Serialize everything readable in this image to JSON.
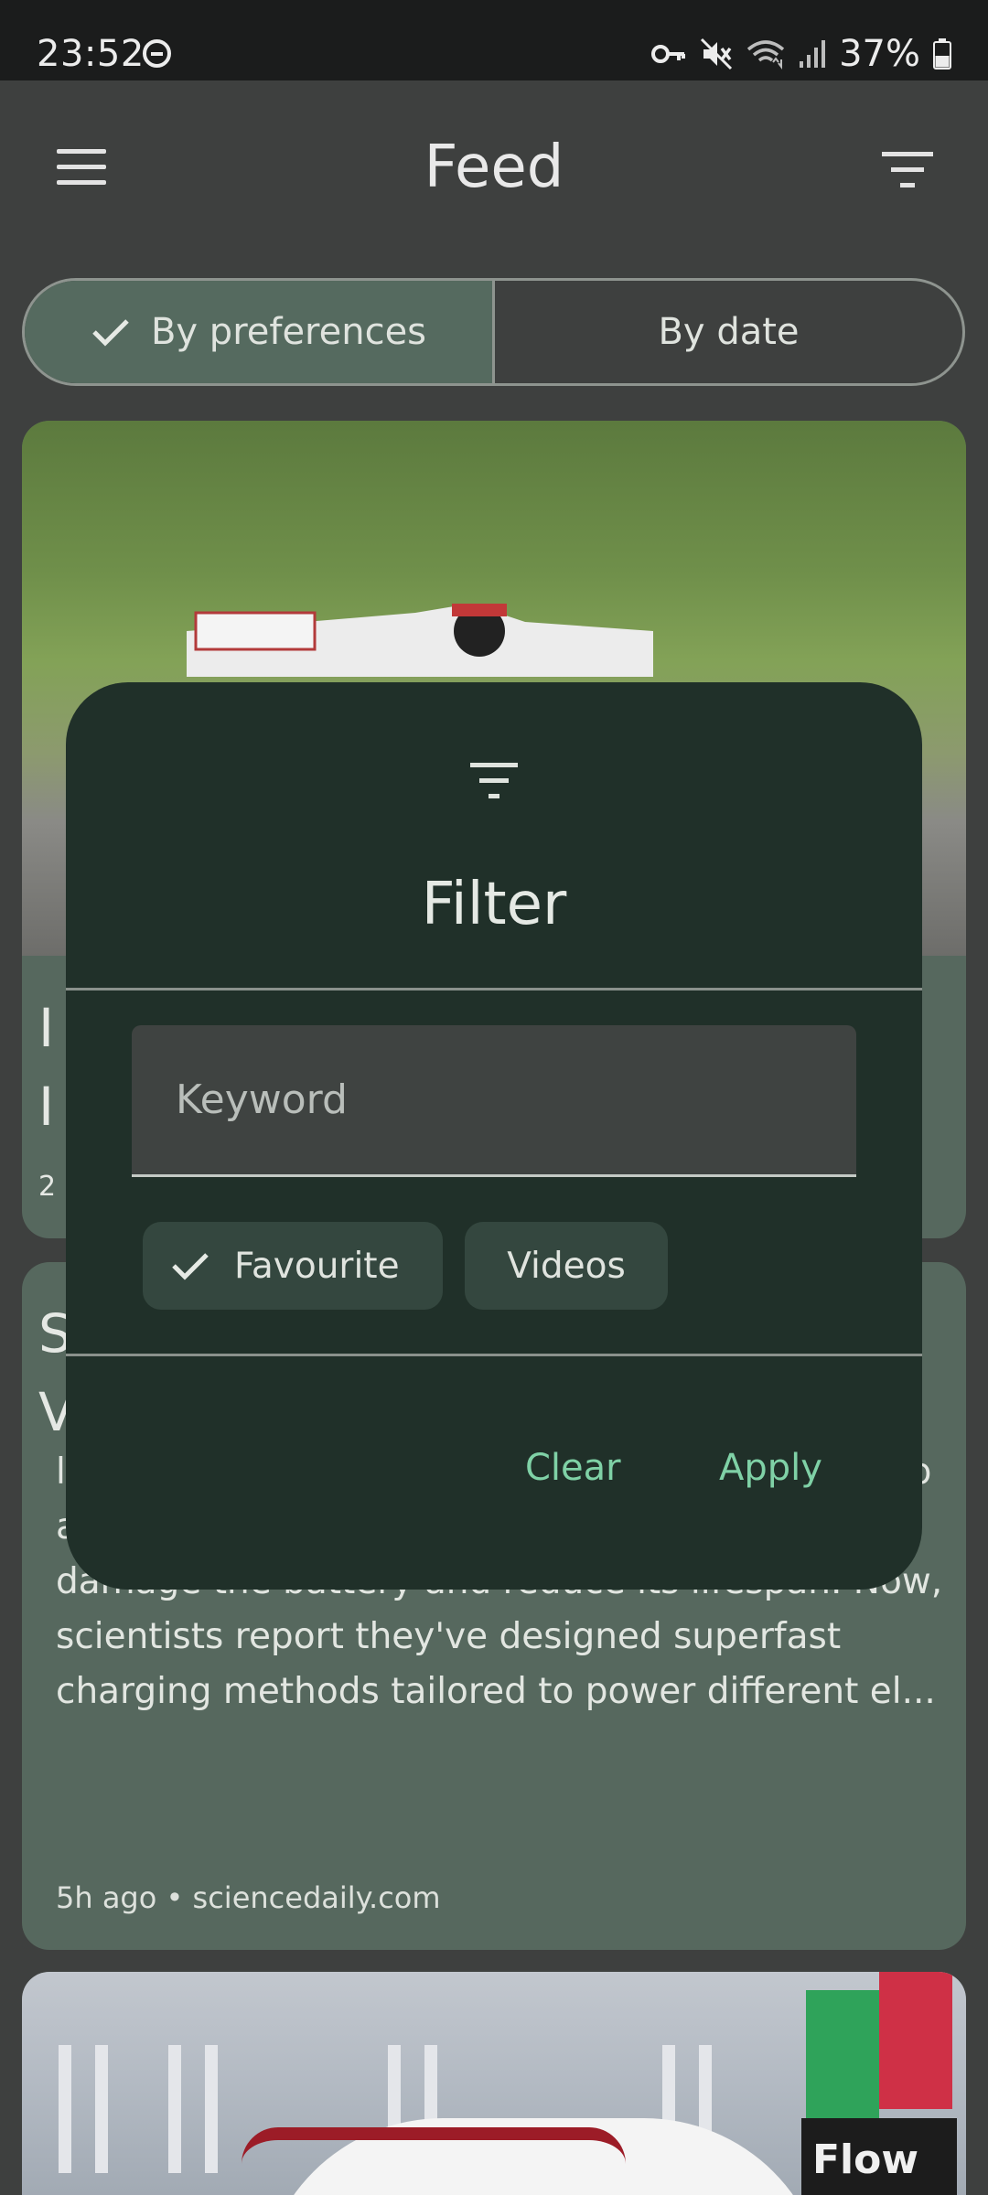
{
  "status_bar": {
    "time": "23:52",
    "battery": "37%",
    "icons": [
      "do-not-disturb-icon",
      "vpn-key-icon",
      "mute-icon",
      "wifi-icon",
      "signal-icon",
      "battery-icon"
    ]
  },
  "app_bar": {
    "title": "Feed",
    "menu_icon": "menu-icon",
    "filter_icon": "filter-icon"
  },
  "sort_toggle": {
    "options": [
      {
        "label": "By preferences",
        "selected": true
      },
      {
        "label": "By date",
        "selected": false
      }
    ]
  },
  "feed": {
    "card2": {
      "body": "longer to power up an electric car than to gas up a conventional one. But charging too fast can damage the battery and reduce its lifespan. Now, scientists report they've designed superfast charging methods tailored to power different el...",
      "meta": "5h ago • sciencedaily.com"
    },
    "card3": {
      "sign_text": "Flow"
    }
  },
  "filter_dialog": {
    "icon": "filter-icon",
    "title": "Filter",
    "keyword_placeholder": "Keyword",
    "keyword_value": "",
    "chips": [
      {
        "label": "Favourite",
        "selected": true
      },
      {
        "label": "Videos",
        "selected": false
      }
    ],
    "clear_label": "Clear",
    "apply_label": "Apply"
  },
  "colors": {
    "background": "#3e403f",
    "card": "#56685e",
    "dialog": "#203029",
    "accent": "#7fd1a6"
  }
}
